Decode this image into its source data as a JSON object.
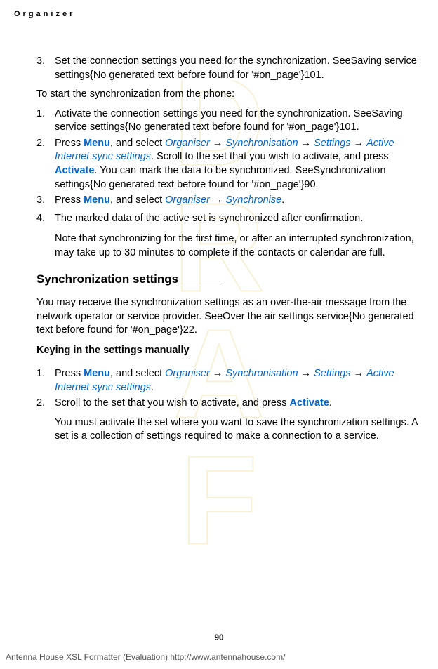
{
  "header": "Organizer",
  "top_list": {
    "item3": {
      "num": "3.",
      "text_a": "Set the connection settings you need for the synchronization. SeeSaving service settings{No generated text before found for '#on_page'}101."
    }
  },
  "para1": "To start the synchronization from the phone:",
  "list2": {
    "item1": {
      "num": "1.",
      "text": "Activate the connection settings you need for the synchronization. SeeSaving service settings{No generated text before found for '#on_page'}101."
    },
    "item2": {
      "num": "2.",
      "pre": "Press ",
      "menu": "Menu",
      "mid1": ", and select ",
      "nav1": "Organiser",
      "arr": " → ",
      "nav2": "Synchronisation",
      "nav3": "Settings",
      "nav4": "Active Internet sync settings",
      "mid2": ". Scroll to the set that you wish to activate, and press ",
      "activate": "Activate",
      "post": ". You can mark the data to be synchronized. SeeSynchronization settings{No generated text before found for '#on_page'}90."
    },
    "item3": {
      "num": "3.",
      "pre": "Press ",
      "menu": "Menu",
      "mid": ", and select ",
      "nav1": "Organiser",
      "arr": " → ",
      "nav2": "Synchronise",
      "post": "."
    },
    "item4": {
      "num": "4.",
      "text": "The marked data of the active set is synchronized after confirmation.",
      "note": "Note that synchronizing for the first time, or after an interrupted synchronization, may take up to 30 minutes to complete if the contacts or calendar are full."
    }
  },
  "h2": "Synchronization settings",
  "para2": "You may receive the synchronization settings as an over-the-air message from the network operator or service provider. SeeOver the air settings service{No generated text before found for '#on_page'}22.",
  "h3": "Keying in the settings manually",
  "list3": {
    "item1": {
      "num": "1.",
      "pre": "Press ",
      "menu": "Menu",
      "mid": ", and select ",
      "nav1": "Organiser",
      "arr": " → ",
      "nav2": "Synchronisation",
      "nav3": "Settings",
      "nav4": "Active Internet sync settings",
      "post": "."
    },
    "item2": {
      "num": "2.",
      "pre": "Scroll to the set that you wish to activate, and press ",
      "activate": "Activate",
      "post": ".",
      "note": "You must activate the set where you want to save the synchronization settings. A set is a collection of settings required to make a connection to a service."
    }
  },
  "page_number": "90",
  "footer": "Antenna House XSL Formatter (Evaluation)  http://www.antennahouse.com/"
}
